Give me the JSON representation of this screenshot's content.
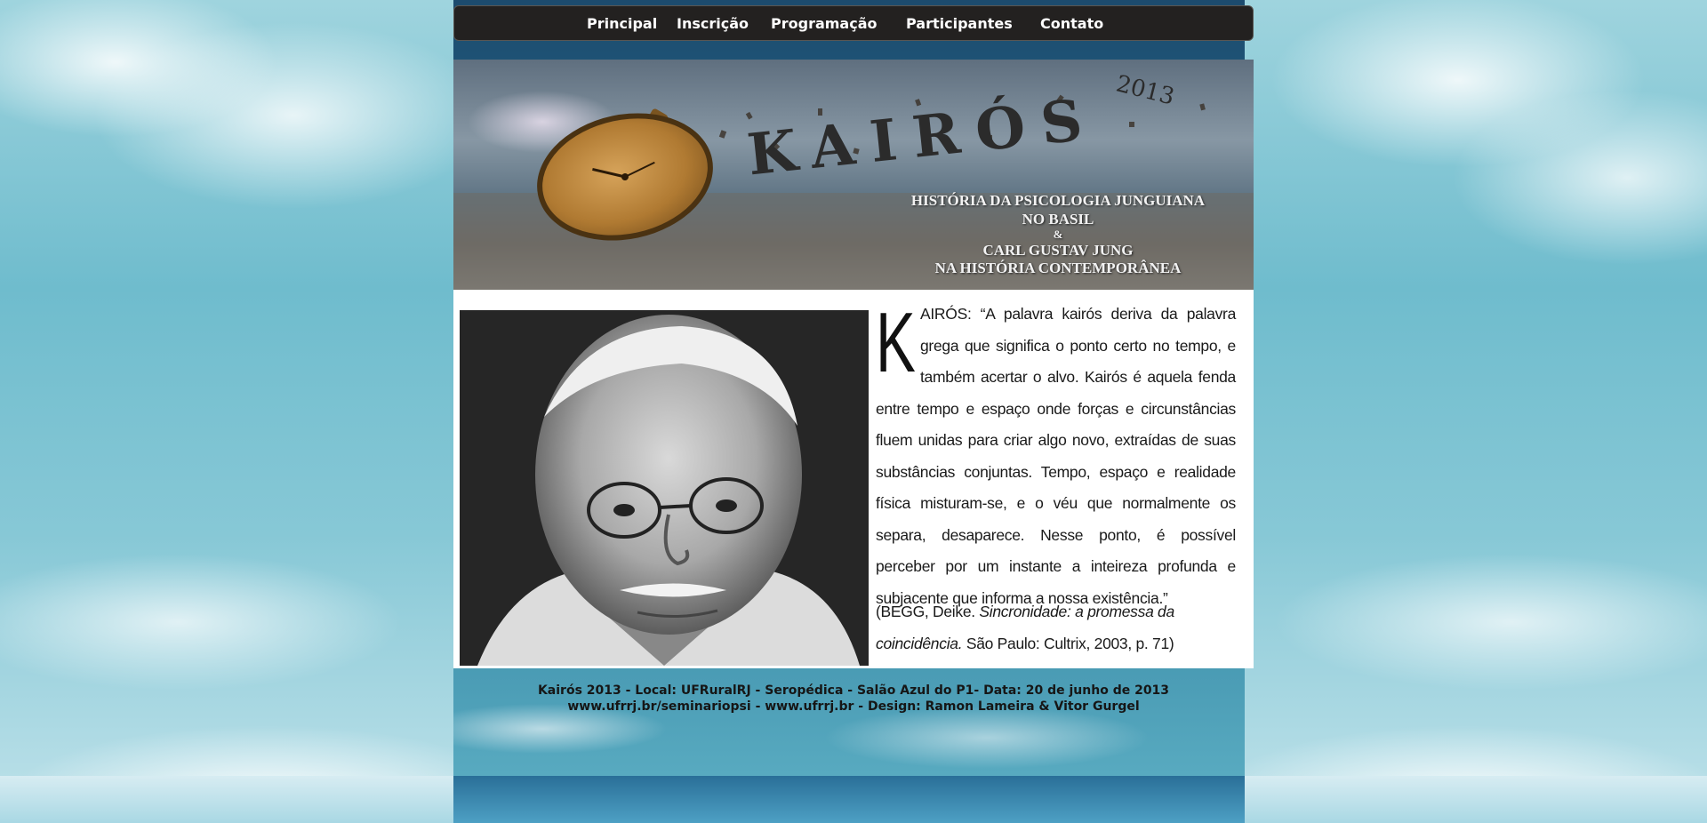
{
  "nav": {
    "items": [
      {
        "label": "Principal"
      },
      {
        "label": "Inscrição"
      },
      {
        "label": "Programação"
      },
      {
        "label": "Participantes"
      },
      {
        "label": "Contato"
      }
    ]
  },
  "banner": {
    "title": "KAIRÓS",
    "year": "2013",
    "subtitle_lines": [
      "HISTÓRIA DA PSICOLOGIA JUNGUIANA",
      "NO BASIL",
      "&",
      "CARL GUSTAV JUNG",
      "NA HISTÓRIA CONTEMPORÂNEA"
    ]
  },
  "main": {
    "quote_dropcap": "K",
    "quote_text": "AIRÓS: “A palavra kairós deriva da palavra grega que significa o ponto certo no tempo, e também acertar o alvo. Kairós é aquela fenda entre tempo e espaço onde forças e circunstâncias fluem unidas para criar algo novo, extraídas de suas substâncias conjuntas. Tempo, espaço e realidade física misturam-se, e o véu que normalmente os separa, desaparece. Nesse ponto, é possível perceber por um instante a inteireza profunda e subjacente que informa a nossa existência.”",
    "citation_prefix": "(BEGG, Deike. ",
    "citation_title": "Sincronidade: a promessa da coincidência.",
    "citation_suffix": " São Paulo: Cultrix, 2003, p. 71)"
  },
  "footer": {
    "line1": "Kairós 2013 - Local: UFRuralRJ - Seropédica - Salão Azul do P1- Data: 20 de junho de 2013",
    "line2": "www.ufrrj.br/seminariopsi - www.ufrrj.br - Design: Ramon Lameira & Vitor Gurgel"
  },
  "colors": {
    "navbar_bg": "#232120",
    "nav_text": "#ffffff",
    "content_bg": "#ffffff",
    "footer_text": "#161616"
  }
}
